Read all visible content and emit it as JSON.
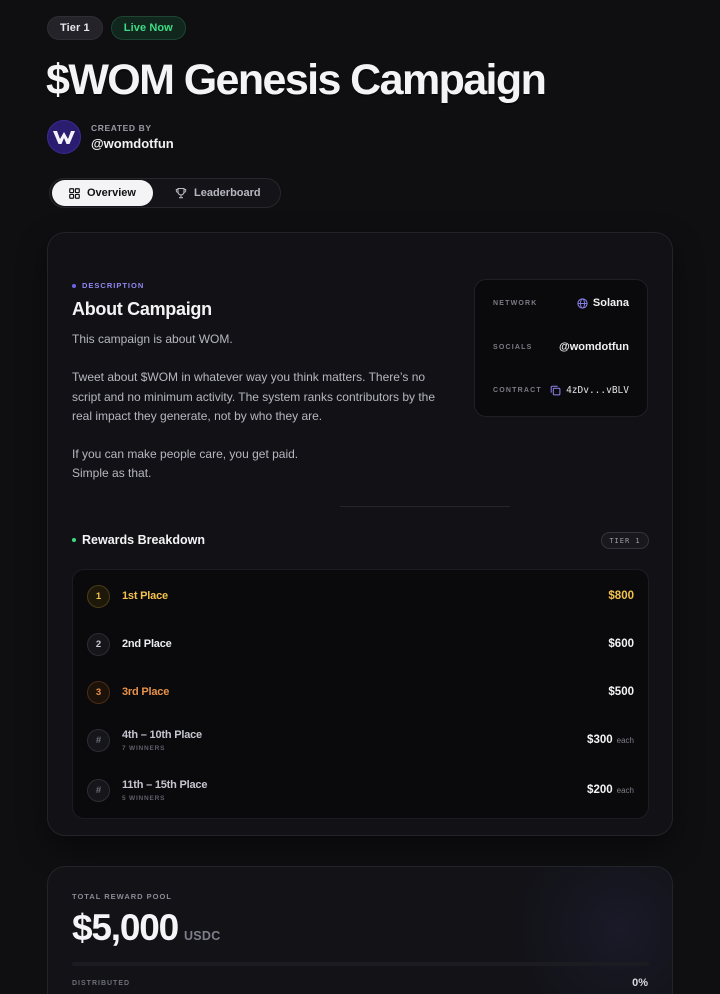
{
  "badges": {
    "tier": "Tier 1",
    "status": "Live Now"
  },
  "campaign": {
    "title": "$WOM Genesis Campaign"
  },
  "creator": {
    "label": "CREATED BY",
    "handle": "@womdotfun"
  },
  "tabs": [
    {
      "label": "Overview",
      "icon": "grid-icon",
      "active": true
    },
    {
      "label": "Leaderboard",
      "icon": "trophy-icon",
      "active": false
    }
  ],
  "about": {
    "kicker": "DESCRIPTION",
    "title": "About Campaign",
    "paragraphs": [
      "This campaign is about WOM.",
      "Tweet about $WOM in whatever way you think matters. There’s no script and no minimum activity. The system ranks contributors by the real impact they generate, not by who they are.",
      "If you can make people care, you get paid.\nSimple as that."
    ]
  },
  "meta": {
    "network": {
      "label": "NETWORK",
      "value": "Solana",
      "icon": "globe-icon"
    },
    "socials": {
      "label": "SOCIALS",
      "value": "@womdotfun"
    },
    "contract": {
      "label": "CONTRACT",
      "value": "4zDv...vBLV",
      "icon": "copy-icon"
    }
  },
  "rewards": {
    "title": "Rewards Breakdown",
    "tier_pill": "TIER 1",
    "rows": [
      {
        "rank": "1",
        "name": "1st Place",
        "sub": "",
        "amount": "$800",
        "each": "",
        "style": "gold"
      },
      {
        "rank": "2",
        "name": "2nd Place",
        "sub": "",
        "amount": "$600",
        "each": "",
        "style": "silver"
      },
      {
        "rank": "3",
        "name": "3rd Place",
        "sub": "",
        "amount": "$500",
        "each": "",
        "style": "bronze"
      },
      {
        "rank": "#",
        "name": "4th – 10th Place",
        "sub": "7 WINNERS",
        "amount": "$300",
        "each": "each",
        "style": "range"
      },
      {
        "rank": "#",
        "name": "11th – 15th Place",
        "sub": "5 WINNERS",
        "amount": "$200",
        "each": "each",
        "style": "range"
      }
    ]
  },
  "pool": {
    "label": "TOTAL REWARD POOL",
    "amount": "$5,000",
    "unit": "USDC",
    "distributed_label": "DISTRIBUTED",
    "distributed_pct": "0%",
    "distributed_fraction": 0
  },
  "colors": {
    "accent_green": "#3ddc84",
    "gold": "#f2c14e",
    "bronze": "#e8924a",
    "purple": "#6f63e8"
  }
}
